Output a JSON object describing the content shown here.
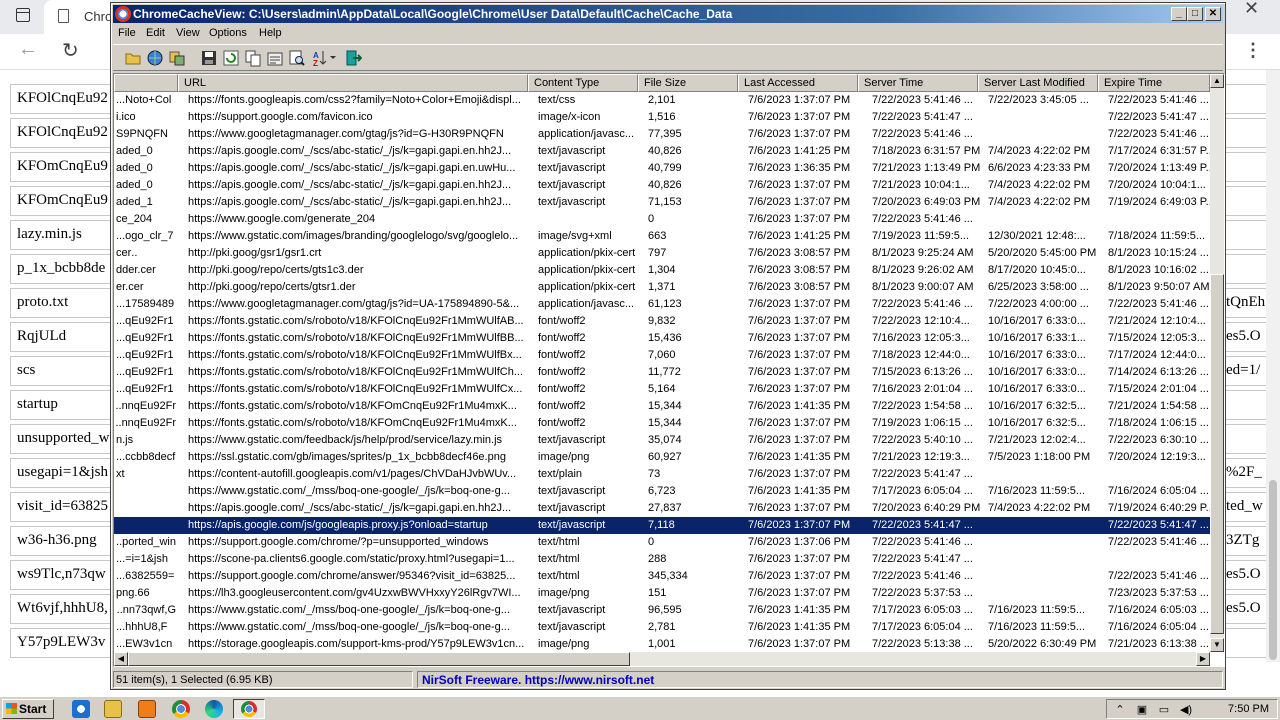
{
  "bg_browser": {
    "tab_title": "Chro",
    "left_items": [
      "KFOlCnqEu92",
      "KFOlCnqEu92",
      "KFOmCnqEu9",
      "KFOmCnqEu9",
      "lazy.min.js",
      "p_1x_bcbb8de",
      "proto.txt",
      "RqjULd",
      "scs",
      "startup",
      "unsupported_w",
      "usegapi=1&jsh",
      "visit_id=63825",
      "w36-h36.png",
      "ws9Tlc,n73qw",
      "Wt6vjf,hhhU8,",
      "Y57p9LEW3v"
    ],
    "right_items": [
      "",
      "",
      "",
      "",
      "",
      "",
      "tQnEh",
      "es5.O",
      "/ed=1",
      "",
      "",
      "_%2F",
      "ted_w",
      "3ZTg",
      "es5.O",
      "es5.O",
      ""
    ]
  },
  "window": {
    "title": "ChromeCacheView:  C:\\Users\\admin\\AppData\\Local\\Google\\Chrome\\User Data\\Default\\Cache\\Cache_Data",
    "menu": [
      "File",
      "Edit",
      "View",
      "Options",
      "Help"
    ],
    "toolbar_icons": [
      "open-folder-icon",
      "globe-icon",
      "copy-files-icon",
      "save-icon",
      "refresh-icon",
      "copy-icon",
      "properties-icon",
      "find-icon",
      "sort-icon",
      "exit-icon"
    ]
  },
  "columns": [
    "",
    "URL",
    "Content Type",
    "File Size",
    "Last Accessed",
    "Server Time",
    "Server Last Modified",
    "Expire Time"
  ],
  "rows": [
    [
      "Noto+Col...",
      "https://fonts.googleapis.com/css2?family=Noto+Color+Emoji&displ...",
      "text/css",
      "2,101",
      "7/6/2023 1:37:07 PM",
      "7/22/2023 5:41:46 ...",
      "7/22/2023 3:45:05 ...",
      "7/22/2023 5:41:46 ..."
    ],
    [
      "i.ico",
      "https://support.google.com/favicon.ico",
      "image/x-icon",
      "1,516",
      "7/6/2023 1:37:07 PM",
      "7/22/2023 5:41:47 ...",
      "",
      "7/22/2023 5:41:47 ..."
    ],
    [
      "S9PNQFN",
      "https://www.googletagmanager.com/gtag/js?id=G-H30R9PNQFN",
      "application/javasc...",
      "77,395",
      "7/6/2023 1:37:07 PM",
      "7/22/2023 5:41:46 ...",
      "",
      "7/22/2023 5:41:46 ..."
    ],
    [
      "aded_0",
      "https://apis.google.com/_/scs/abc-static/_/js/k=gapi.gapi.en.hh2J...",
      "text/javascript",
      "40,826",
      "7/6/2023 1:41:25 PM",
      "7/18/2023 6:31:57 PM",
      "7/4/2023 4:22:02 PM",
      "7/17/2024 6:31:57 P..."
    ],
    [
      "aded_0",
      "https://apis.google.com/_/scs/abc-static/_/js/k=gapi.gapi.en.uwHu...",
      "text/javascript",
      "40,799",
      "7/6/2023 1:36:35 PM",
      "7/21/2023 1:13:49 PM",
      "6/6/2023 4:23:33 PM",
      "7/20/2024 1:13:49 P..."
    ],
    [
      "aded_0",
      "https://apis.google.com/_/scs/abc-static/_/js/k=gapi.gapi.en.hh2J...",
      "text/javascript",
      "40,826",
      "7/6/2023 1:37:07 PM",
      "7/21/2023 10:04:1...",
      "7/4/2023 4:22:02 PM",
      "7/20/2024 10:04:1..."
    ],
    [
      "aded_1",
      "https://apis.google.com/_/scs/abc-static/_/js/k=gapi.gapi.en.hh2J...",
      "text/javascript",
      "71,153",
      "7/6/2023 1:37:07 PM",
      "7/20/2023 6:49:03 PM",
      "7/4/2023 4:22:02 PM",
      "7/19/2024 6:49:03 P..."
    ],
    [
      "ce_204",
      "https://www.google.com/generate_204",
      "",
      "0",
      "7/6/2023 1:37:07 PM",
      "7/22/2023 5:41:46 ...",
      "",
      ""
    ],
    [
      "ogo_clr_7...",
      "https://www.gstatic.com/images/branding/googlelogo/svg/googlelo...",
      "image/svg+xml",
      "663",
      "7/6/2023 1:41:25 PM",
      "7/19/2023 11:59:5...",
      "12/30/2021 12:48:...",
      "7/18/2024 11:59:5..."
    ],
    [
      "..cer",
      "http://pki.goog/gsr1/gsr1.crt",
      "application/pkix-cert",
      "797",
      "7/6/2023 3:08:57 PM",
      "8/1/2023 9:25:24 AM",
      "5/20/2020 5:45:00 PM",
      "8/1/2023 10:15:24 ..."
    ],
    [
      "dder.cer",
      "http://pki.goog/repo/certs/gts1c3.der",
      "application/pkix-cert",
      "1,304",
      "7/6/2023 3:08:57 PM",
      "8/1/2023 9:26:02 AM",
      "8/17/2020 10:45:0...",
      "8/1/2023 10:16:02 ..."
    ],
    [
      "er.cer",
      "http://pki.goog/repo/certs/gtsr1.der",
      "application/pkix-cert",
      "1,371",
      "7/6/2023 3:08:57 PM",
      "8/1/2023 9:00:07 AM",
      "6/25/2023 3:58:00 ...",
      "8/1/2023 9:50:07 AM"
    ],
    [
      "17589489...",
      "https://www.googletagmanager.com/gtag/js?id=UA-175894890-5&...",
      "application/javasc...",
      "61,123",
      "7/6/2023 1:37:07 PM",
      "7/22/2023 5:41:46 ...",
      "7/22/2023 4:00:00 ...",
      "7/22/2023 5:41:46 ..."
    ],
    [
      "qEu92Fr1...",
      "https://fonts.gstatic.com/s/roboto/v18/KFOlCnqEu92Fr1MmWUlfAB...",
      "font/woff2",
      "9,832",
      "7/6/2023 1:37:07 PM",
      "7/22/2023 12:10:4...",
      "10/16/2017 6:33:0...",
      "7/21/2024 12:10:4..."
    ],
    [
      "qEu92Fr1...",
      "https://fonts.gstatic.com/s/roboto/v18/KFOlCnqEu92Fr1MmWUlfBB...",
      "font/woff2",
      "15,436",
      "7/6/2023 1:37:07 PM",
      "7/16/2023 12:05:3...",
      "10/16/2017 6:33:1...",
      "7/15/2024 12:05:3..."
    ],
    [
      "qEu92Fr1...",
      "https://fonts.gstatic.com/s/roboto/v18/KFOlCnqEu92Fr1MmWUlfBx...",
      "font/woff2",
      "7,060",
      "7/6/2023 1:37:07 PM",
      "7/18/2023 12:44:0...",
      "10/16/2017 6:33:0...",
      "7/17/2024 12:44:0..."
    ],
    [
      "qEu92Fr1...",
      "https://fonts.gstatic.com/s/roboto/v18/KFOlCnqEu92Fr1MmWUlfCh...",
      "font/woff2",
      "11,772",
      "7/6/2023 1:37:07 PM",
      "7/15/2023 6:13:26 ...",
      "10/16/2017 6:33:0...",
      "7/14/2024 6:13:26 ..."
    ],
    [
      "qEu92Fr1...",
      "https://fonts.gstatic.com/s/roboto/v18/KFOlCnqEu92Fr1MmWUlfCx...",
      "font/woff2",
      "5,164",
      "7/6/2023 1:37:07 PM",
      "7/16/2023 2:01:04 ...",
      "10/16/2017 6:33:0...",
      "7/15/2024 2:01:04 ..."
    ],
    [
      "nnqEu92Fr...",
      "https://fonts.gstatic.com/s/roboto/v18/KFOmCnqEu92Fr1Mu4mxK...",
      "font/woff2",
      "15,344",
      "7/6/2023 1:41:35 PM",
      "7/22/2023 1:54:58 ...",
      "10/16/2017 6:32:5...",
      "7/21/2024 1:54:58 ..."
    ],
    [
      "nnqEu92Fr...",
      "https://fonts.gstatic.com/s/roboto/v18/KFOmCnqEu92Fr1Mu4mxK...",
      "font/woff2",
      "15,344",
      "7/6/2023 1:37:07 PM",
      "7/19/2023 1:06:15 ...",
      "10/16/2017 6:32:5...",
      "7/18/2024 1:06:15 ..."
    ],
    [
      "n.js",
      "https://www.gstatic.com/feedback/js/help/prod/service/lazy.min.js",
      "text/javascript",
      "35,074",
      "7/6/2023 1:37:07 PM",
      "7/22/2023 5:40:10 ...",
      "7/21/2023 12:02:4...",
      "7/22/2023 6:30:10 ..."
    ],
    [
      "ccbb8decf...",
      "https://ssl.gstatic.com/gb/images/sprites/p_1x_bcbb8decf46e.png",
      "image/png",
      "60,927",
      "7/6/2023 1:41:35 PM",
      "7/21/2023 12:19:3...",
      "7/5/2023 1:18:00 PM",
      "7/20/2024 12:19:3..."
    ],
    [
      "xt",
      "https://content-autofill.googleapis.com/v1/pages/ChVDaHJvbWUv...",
      "text/plain",
      "73",
      "7/6/2023 1:37:07 PM",
      "7/22/2023 5:41:47 ...",
      "",
      ""
    ],
    [
      "",
      "https://www.gstatic.com/_/mss/boq-one-google/_/js/k=boq-one-g...",
      "text/javascript",
      "6,723",
      "7/6/2023 1:41:35 PM",
      "7/17/2023 6:05:04 ...",
      "7/16/2023 11:59:5...",
      "7/16/2024 6:05:04 ..."
    ],
    [
      "",
      "https://apis.google.com/_/scs/abc-static/_/js/k=gapi.gapi.en.hh2J...",
      "text/javascript",
      "27,837",
      "7/6/2023 1:37:07 PM",
      "7/20/2023 6:40:29 PM",
      "7/4/2023 4:22:02 PM",
      "7/19/2024 6:40:29 P..."
    ],
    [
      "",
      "https://apis.google.com/js/googleapis.proxy.js?onload=startup",
      "text/javascript",
      "7,118",
      "7/6/2023 1:37:07 PM",
      "7/22/2023 5:41:47 ...",
      "",
      "7/22/2023 5:41:47 ..."
    ],
    [
      "ported_win...",
      "https://support.google.com/chrome/?p=unsupported_windows",
      "text/html",
      "0",
      "7/6/2023 1:37:06 PM",
      "7/22/2023 5:41:46 ...",
      "",
      "7/22/2023 5:41:46 ..."
    ],
    [
      "i=1&jsh=...",
      "https://scone-pa.clients6.google.com/static/proxy.html?usegapi=1...",
      "text/html",
      "288",
      "7/6/2023 1:37:07 PM",
      "7/22/2023 5:41:47 ...",
      "",
      ""
    ],
    [
      "=6382559...",
      "https://support.google.com/chrome/answer/95346?visit_id=63825...",
      "text/html",
      "345,334",
      "7/6/2023 1:37:07 PM",
      "7/22/2023 5:41:46 ...",
      "",
      "7/22/2023 5:41:46 ..."
    ],
    [
      "66.png",
      "https://lh3.googleusercontent.com/gv4UzxwBWVHxxyY26lRgv7WI...",
      "image/png",
      "151",
      "7/6/2023 1:37:07 PM",
      "7/22/2023 5:37:53 ...",
      "",
      "7/23/2023 5:37:53 ..."
    ],
    [
      "nn73qwf,G...",
      "https://www.gstatic.com/_/mss/boq-one-google/_/js/k=boq-one-g...",
      "text/javascript",
      "96,595",
      "7/6/2023 1:41:35 PM",
      "7/17/2023 6:05:03 ...",
      "7/16/2023 11:59:5...",
      "7/16/2024 6:05:03 ..."
    ],
    [
      "hhhU8,F...",
      "https://www.gstatic.com/_/mss/boq-one-google/_/js/k=boq-one-g...",
      "text/javascript",
      "2,781",
      "7/6/2023 1:41:35 PM",
      "7/17/2023 6:05:04 ...",
      "7/16/2023 11:59:5...",
      "7/16/2024 6:05:04 ..."
    ],
    [
      "EW3v1cn...",
      "https://storage.googleapis.com/support-kms-prod/Y57p9LEW3v1cn...",
      "image/png",
      "1,001",
      "7/6/2023 1:37:07 PM",
      "7/22/2023 5:13:38 ...",
      "5/20/2022 6:30:49 PM",
      "7/21/2023 6:13:38 ..."
    ]
  ],
  "selected_row": 25,
  "status": {
    "items": "51 item(s), 1 Selected  (6.95 KB)",
    "credit": "NirSoft Freeware. https://www.nirsoft.net"
  },
  "taskbar": {
    "start_label": "Start",
    "clock": "7:50 PM",
    "quick_launch": [
      "ie-icon",
      "folder-icon",
      "media-player-icon",
      "chrome-icon",
      "edge-icon"
    ]
  }
}
